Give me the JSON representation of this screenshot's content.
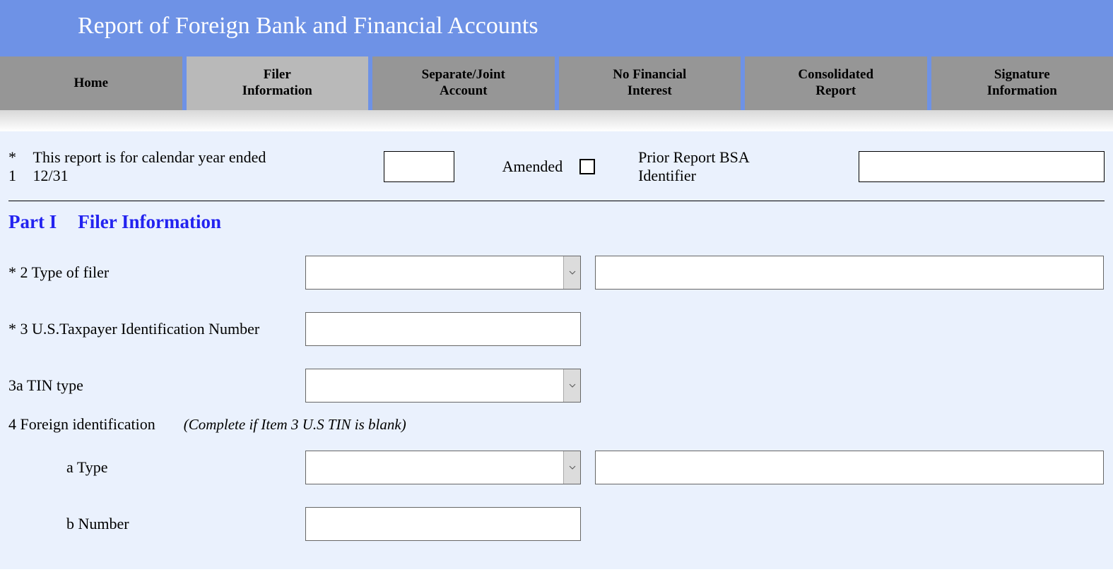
{
  "header": {
    "title": "Report of Foreign Bank and Financial Accounts"
  },
  "tabs": [
    "Home",
    "Filer Information",
    "Separate/Joint Account",
    "No Financial Interest",
    "Consolidated Report",
    "Signature Information"
  ],
  "active_tab": 1,
  "row1": {
    "label_prefix": "* 1",
    "label": "This report is for calendar year ended 12/31",
    "year_value": "",
    "amended_label": "Amended",
    "amended_checked": false,
    "prior_label": "Prior Report BSA Identifier",
    "prior_value": ""
  },
  "part_header": {
    "part": "Part I",
    "title": "Filer Information"
  },
  "fields": {
    "f2_label": "* 2 Type of filer",
    "f2_select_value": "",
    "f2_text_value": "",
    "f3_label": "* 3 U.S.Taxpayer Identification Number",
    "f3_value": "",
    "f3a_label": "3a TIN type",
    "f3a_value": "",
    "f4_label": "4 Foreign identification",
    "f4_hint": "(Complete if Item 3 U.S TIN is blank)",
    "f4a_label": "a Type",
    "f4a_select_value": "",
    "f4a_text_value": "",
    "f4b_label": "b Number",
    "f4b_value": ""
  }
}
